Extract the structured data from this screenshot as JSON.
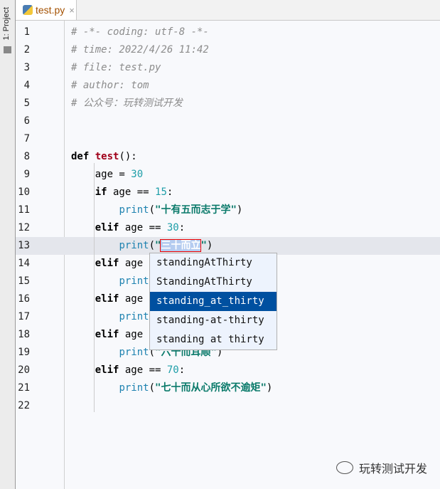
{
  "sidebar": {
    "project_label": "1: Project"
  },
  "tab": {
    "filename": "test.py",
    "close": "×"
  },
  "lines": [
    {
      "n": "1",
      "html": "<span class='cm'># -*- coding: utf-8 -*-</span>"
    },
    {
      "n": "2",
      "html": "<span class='cm'># time: 2022/4/26 11:42</span>"
    },
    {
      "n": "3",
      "html": "<span class='cm'># file: test.py</span>"
    },
    {
      "n": "4",
      "html": "<span class='cm'># author: tom</span>"
    },
    {
      "n": "5",
      "html": "<span class='cm'># 公众号：玩转测试开发</span>"
    },
    {
      "n": "6",
      "html": ""
    },
    {
      "n": "7",
      "html": ""
    },
    {
      "n": "8",
      "html": "<span class='kw'>def</span> <span class='fn'>test</span>():"
    },
    {
      "n": "9",
      "html": "    age = <span class='num'>30</span>"
    },
    {
      "n": "10",
      "html": "    <span class='kw'>if</span> age == <span class='num'>15</span>:"
    },
    {
      "n": "11",
      "html": "        <span class='bi'>print</span>(<span class='str'>\"十有五而志于学\"</span>)"
    },
    {
      "n": "12",
      "html": "    <span class='kw'>elif</span> age == <span class='num'>30</span>:"
    },
    {
      "n": "13",
      "html": "        <span class='bi'>print</span>(<span class='str'>\"<span class='sel'>三十而立</span>\"</span>)"
    },
    {
      "n": "14",
      "html": "    <span class='kw'>elif</span> age == <span class='num'>40</span>:"
    },
    {
      "n": "15",
      "html": "        <span class='bi'>print</span>(<span class='str'>\"四十而不惑\"</span>)"
    },
    {
      "n": "16",
      "html": "    <span class='kw'>elif</span> age == <span class='num'>50</span>:"
    },
    {
      "n": "17",
      "html": "        <span class='bi'>print</span>(<span class='str'>\"五十而知天命\"</span>)"
    },
    {
      "n": "18",
      "html": "    <span class='kw'>elif</span> age == <span class='num'>60</span>:"
    },
    {
      "n": "19",
      "html": "        <span class='bi'>print</span>(<span class='str'>\"六十而耳顺\"</span>)"
    },
    {
      "n": "20",
      "html": "    <span class='kw'>elif</span> age == <span class='num'>70</span>:"
    },
    {
      "n": "21",
      "html": "        <span class='bi'>print</span>(<span class='str'>\"七十而从心所欲不逾矩\"</span>)"
    },
    {
      "n": "22",
      "html": ""
    }
  ],
  "current_line": "13",
  "completion": {
    "items": [
      "standingAtThirty",
      "StandingAtThirty",
      "standing_at_thirty",
      "standing-at-thirty",
      "standing at thirty"
    ],
    "selected_index": 2
  },
  "watermark": {
    "text": "玩转测试开发"
  }
}
